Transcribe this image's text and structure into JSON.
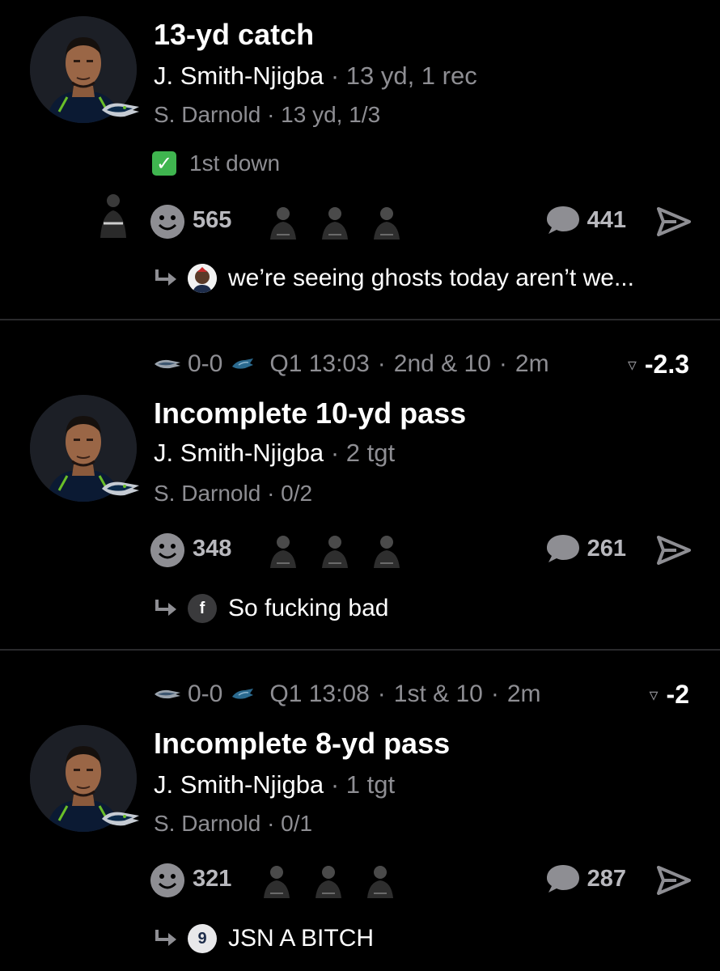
{
  "colors": {
    "background": "#000000",
    "dim_text": "#8e8e93",
    "check_green": "#3fb54f",
    "divider": "#2a2a2c"
  },
  "plays": [
    {
      "title": "13-yd catch",
      "receiver": "J. Smith-Njigba",
      "receiver_stat": "· 13 yd, 1 rec",
      "passer": "S. Darnold",
      "passer_stat": "· 13 yd, 1/3",
      "badge_text": "1st down",
      "reaction_count": "565",
      "comment_count": "441",
      "reply_text": "we’re seeing ghosts today aren’t we..."
    },
    {
      "score": "0-0",
      "clock": "Q1 13:03",
      "down": "2nd & 10",
      "age": "2m",
      "wp_delta": "-2.3",
      "title": "Incomplete 10-yd pass",
      "receiver": "J. Smith-Njigba",
      "receiver_stat": "· 2 tgt",
      "passer": "S. Darnold",
      "passer_stat": "· 0/2",
      "reaction_count": "348",
      "comment_count": "261",
      "reply_avatar_letter": "f",
      "reply_text": "So fucking bad"
    },
    {
      "score": "0-0",
      "clock": "Q1 13:08",
      "down": "1st & 10",
      "age": "2m",
      "wp_delta": "-2",
      "title": "Incomplete 8-yd pass",
      "receiver": "J. Smith-Njigba",
      "receiver_stat": "· 1 tgt",
      "passer": "S. Darnold",
      "passer_stat": "· 0/1",
      "reaction_count": "321",
      "comment_count": "287",
      "reply_avatar_letter": "9",
      "reply_text": "JSN A BITCH"
    }
  ],
  "separator": "·",
  "icons": {
    "reaction": "smiley-face-icon",
    "comment": "speech-bubble-icon",
    "share": "send-arrow-icon",
    "reply": "reply-arrow-icon",
    "check": "checkmark-icon",
    "wp": "win-probability-icon"
  }
}
